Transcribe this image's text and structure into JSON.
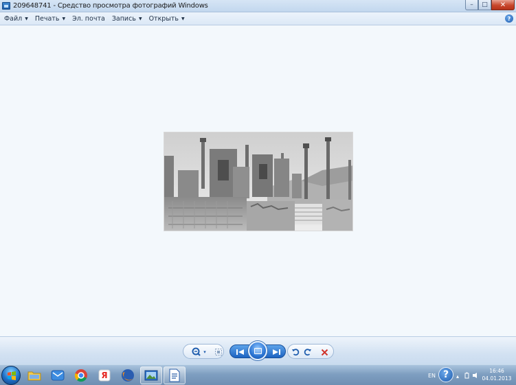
{
  "window": {
    "title": "209648741 - Средство просмотра фотографий Windows",
    "icon": "photo-viewer-icon",
    "minimize_glyph": "–",
    "maximize_glyph": "□",
    "close_glyph": "✕"
  },
  "menu": {
    "items": [
      {
        "label": "Файл",
        "has_arrow": true
      },
      {
        "label": "Печать",
        "has_arrow": true
      },
      {
        "label": "Эл. почта",
        "has_arrow": false
      },
      {
        "label": "Запись",
        "has_arrow": true
      },
      {
        "label": "Открыть",
        "has_arrow": true
      }
    ],
    "arrow_glyph": "▼",
    "help_glyph": "?"
  },
  "photo": {
    "subject": "ancient-ruins-photo"
  },
  "toolbar": {
    "buttons": [
      "zoom-icon",
      "fit-window-icon",
      "previous-icon",
      "slideshow-icon",
      "next-icon",
      "rotate-left-icon",
      "rotate-right-icon",
      "delete-icon"
    ],
    "zoom_arrow_glyph": "▾"
  },
  "taskbar": {
    "pinned": [
      "folder-icon",
      "mail-icon",
      "chrome-icon",
      "yandex-icon",
      "firefox-icon",
      "photo-viewer-icon",
      "document-icon"
    ],
    "yandex_glyph": "Я",
    "tray": {
      "language": "EN",
      "help_glyph": "?",
      "arrow_glyph": "▴",
      "time": "16:46",
      "date": "04.01.2013"
    }
  },
  "colors": {
    "accent": "#1d63c1",
    "close": "#c8472c",
    "viewer_bg": "#f3f8fc",
    "delete": "#d0342c"
  }
}
